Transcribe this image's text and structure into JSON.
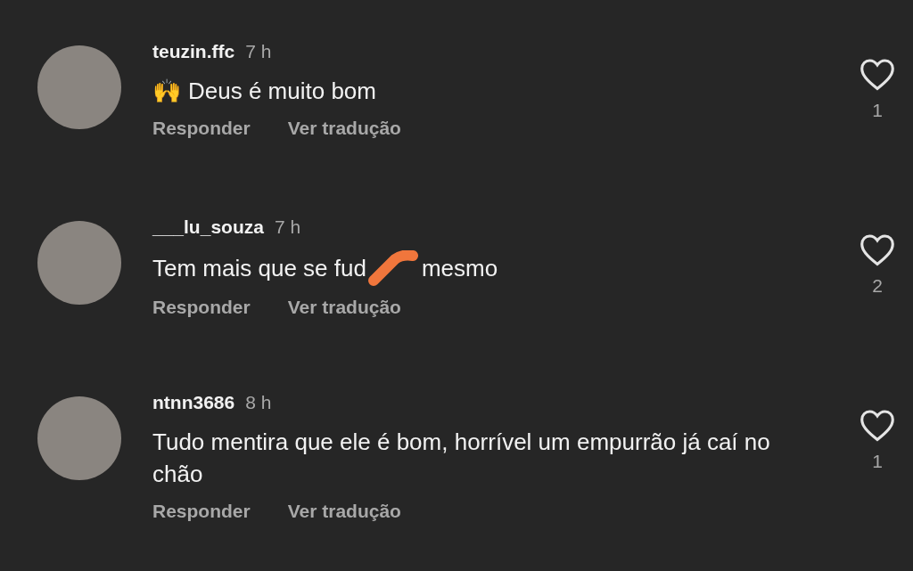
{
  "comments": [
    {
      "username": "teuzin.ffc",
      "time": "7 h",
      "emoji": "🙌",
      "content": [
        {
          "kind": "text",
          "text": "Deus é muito bom"
        }
      ],
      "actions": [
        "Responder",
        "Ver tradução"
      ],
      "likes": "1"
    },
    {
      "username": "___lu_souza",
      "time": "7 h",
      "content": [
        {
          "kind": "text",
          "text": "Tem mais que se fud"
        },
        {
          "kind": "scribble"
        },
        {
          "kind": "text",
          "text": "mesmo"
        }
      ],
      "actions": [
        "Responder",
        "Ver tradução"
      ],
      "likes": "2"
    },
    {
      "username": "ntnn3686",
      "time": "8 h",
      "content": [
        {
          "kind": "text",
          "text": "Tudo mentira que ele é bom, horrível um empurrão já caí no chão"
        }
      ],
      "actions": [
        "Responder",
        "Ver tradução"
      ],
      "likes": "1"
    }
  ]
}
